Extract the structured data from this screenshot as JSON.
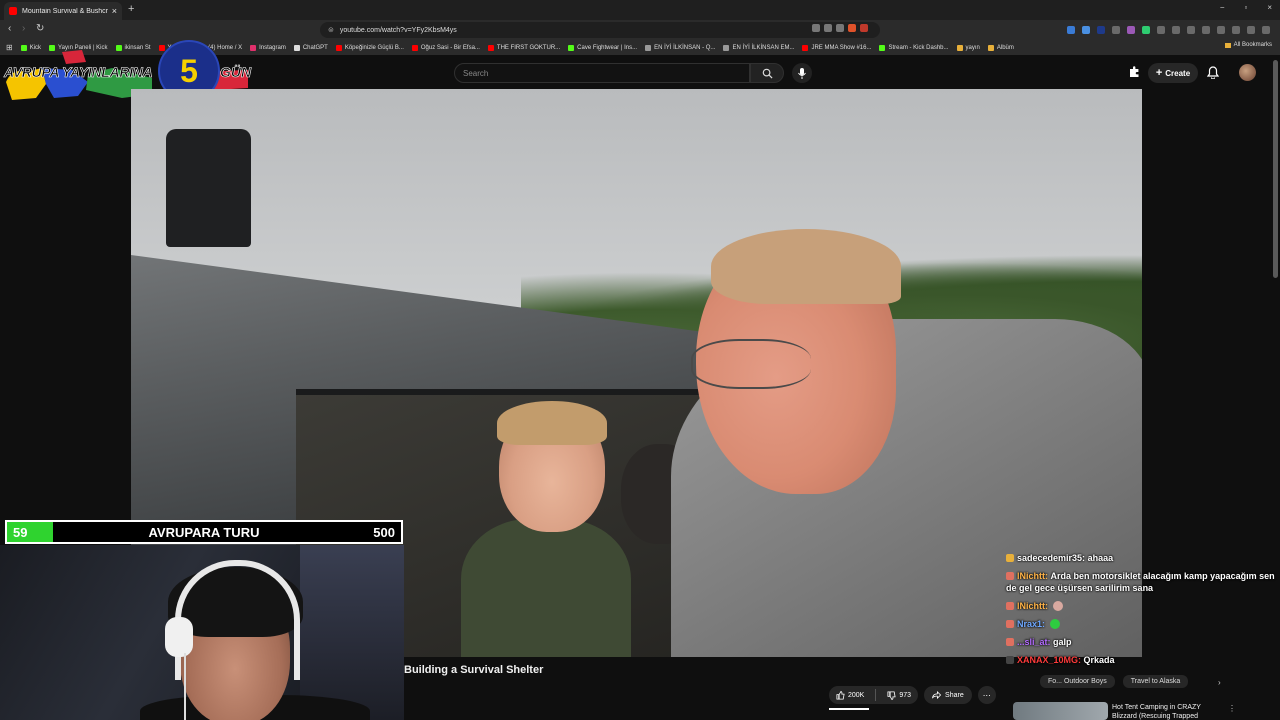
{
  "browser": {
    "tab_title": "Mountain Survival & Bushcra",
    "tab_close": "×",
    "new_tab": "+",
    "url": "youtube.com/watch?v=YFy2KbsM4ys",
    "window_controls": [
      "−",
      "▫",
      "×"
    ],
    "bookmarks": [
      {
        "label": "Kick",
        "color": "#53fc18"
      },
      {
        "label": "Yayın Paneli | Kick",
        "color": "#53fc18"
      },
      {
        "label": "ikinsan St",
        "color": "#53fc18"
      },
      {
        "label": "YouTube",
        "color": "#ff0000"
      },
      {
        "label": "(4) Home / X",
        "color": "#aaaaaa"
      },
      {
        "label": "Instagram",
        "color": "#e1306c"
      },
      {
        "label": "ChatGPT",
        "color": "#dddddd"
      },
      {
        "label": "Köpeğinizle Güçlü B...",
        "color": "#ff0000"
      },
      {
        "label": "Oğuz Sasi - Bir Efsa...",
        "color": "#ff0000"
      },
      {
        "label": "THE FIRST GOKTUR...",
        "color": "#ff0000"
      },
      {
        "label": "Cave Fightwear | Ins...",
        "color": "#53fc18"
      },
      {
        "label": "EN İYİ İLKİNSAN - Q...",
        "color": "#999999"
      },
      {
        "label": "EN İYİ İLKİNSAN EM...",
        "color": "#999999"
      },
      {
        "label": "JRE MMA Show #16...",
        "color": "#ff0000"
      },
      {
        "label": "Stream - Kick Dashb...",
        "color": "#53fc18"
      },
      {
        "label": "yayın",
        "color": "#e8b03a"
      },
      {
        "label": "Albüm",
        "color": "#e8b03a"
      }
    ],
    "all_bookmarks": "All Bookmarks"
  },
  "youtube": {
    "search_placeholder": "Search",
    "create_label": "Create",
    "video_title": "Building a Survival Shelter",
    "like_count": "200K",
    "dislike_count": "973",
    "share_label": "Share",
    "chips": [
      "Fo... Outdoor Boys",
      "Travel to Alaska"
    ],
    "rec_title": "Hot Tent Camping in CRAZY Blizzard (Rescuing Trapped"
  },
  "overlay": {
    "logo_text": "AVRUPA YAYINLARINA",
    "logo_suffix": "GÜN",
    "logo_number": "5",
    "goal_current": "59",
    "goal_name": "AVRUPARA TURU",
    "goal_target": "500",
    "goal_progress_fraction": 0.118
  },
  "chat": [
    {
      "user": "sadecedemir35:",
      "user_color": "#ffffff",
      "msg": "ahaaa",
      "badge_color": "#e8b03a"
    },
    {
      "user": "lNichtt:",
      "user_color": "#ffb347",
      "msg": "Arda ben motorsiklet alacağım kamp yapacağım sen de gel gece üşürsen sarilirim sana",
      "badge_color": "#e07060"
    },
    {
      "user": "lNichtt:",
      "user_color": "#ffb347",
      "msg": "",
      "badge_color": "#e07060"
    },
    {
      "user": "Nrax1:",
      "user_color": "#6fa8ff",
      "msg": "",
      "badge_color": "#e07060"
    },
    {
      "user": "...sli_at:",
      "user_color": "#b36bff",
      "msg": "galp",
      "badge_color": "#e07060"
    },
    {
      "user": "XANAX_10MG:",
      "user_color": "#ff3b3b",
      "msg": "Qrkada",
      "badge_color": "#444444"
    }
  ]
}
